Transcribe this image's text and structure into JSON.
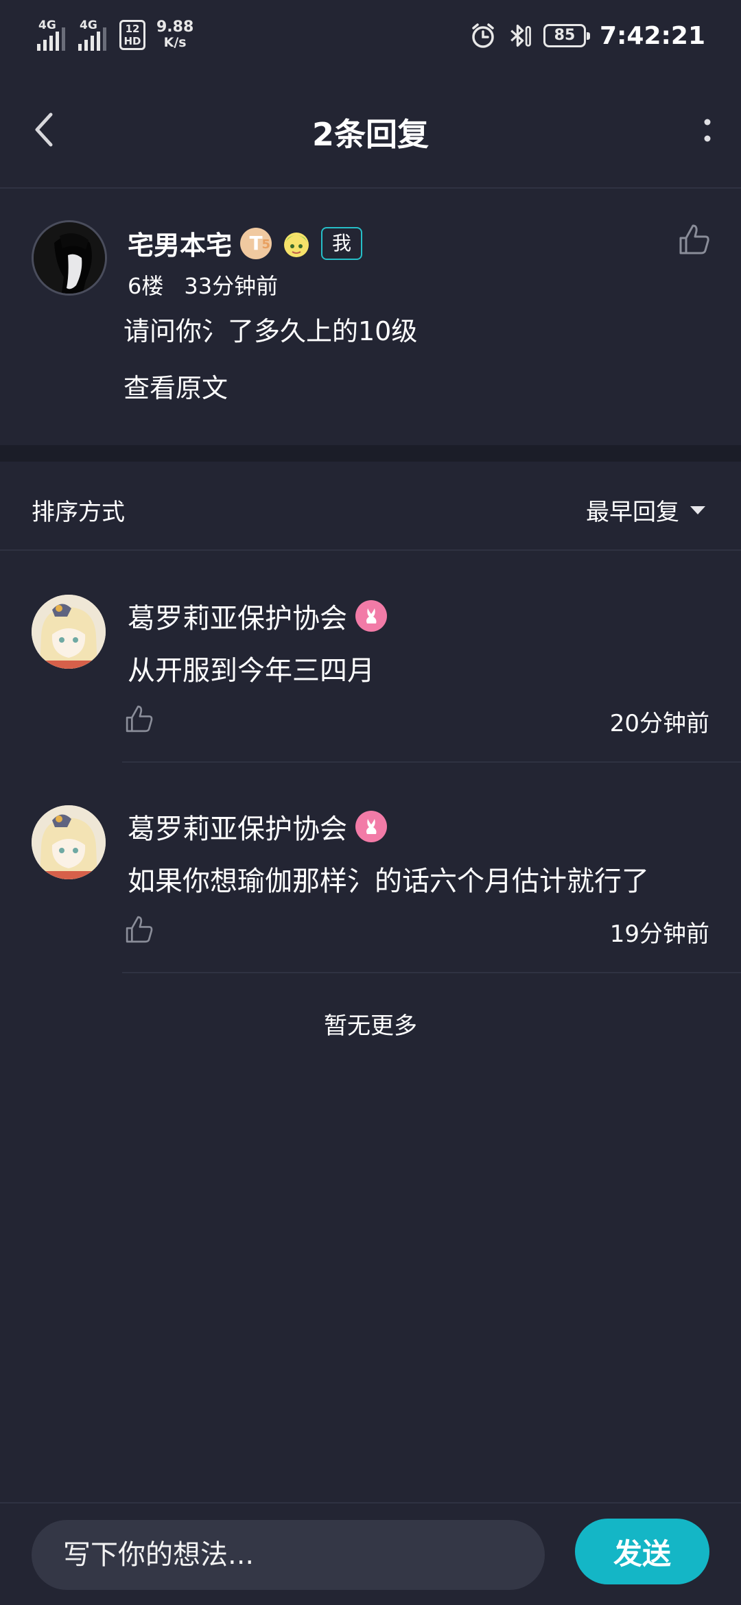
{
  "status_bar": {
    "network_1": "4G",
    "network_2": "4G",
    "hd_label_top": "12",
    "hd_label_bottom": "HD",
    "speed_value": "9.88",
    "speed_unit": "K/s",
    "battery": "85",
    "time": "7:42:21",
    "icons": [
      "signal-icon",
      "signal-icon",
      "hd-icon",
      "alarm-icon",
      "bluetooth-icon",
      "battery-icon"
    ]
  },
  "header": {
    "title": "2条回复",
    "back_icon": "chevron-left-icon",
    "more_icon": "more-vertical-icon"
  },
  "original_comment": {
    "username": "宅男本宅",
    "level_badge": "T",
    "level_badge_sub": "5",
    "me_tag": "我",
    "floor": "6楼",
    "time": "33分钟前",
    "text": "请问你氵了多久上的10级",
    "view_original": "查看原文"
  },
  "sort": {
    "label": "排序方式",
    "selected": "最早回复"
  },
  "replies": [
    {
      "username": "葛罗莉亚保护协会",
      "text": "从开服到今年三四月",
      "time": "20分钟前"
    },
    {
      "username": "葛罗莉亚保护协会",
      "text": "如果你想瑜伽那样氵的话六个月估计就行了",
      "time": "19分钟前"
    }
  ],
  "no_more": "暂无更多",
  "bottom_bar": {
    "input_placeholder": "写下你的想法...",
    "send_label": "发送"
  },
  "colors": {
    "background": "#232533",
    "accent": "#14b6c6",
    "me_tag_border": "#26bfc8",
    "badge_pink": "#f27ba7"
  }
}
